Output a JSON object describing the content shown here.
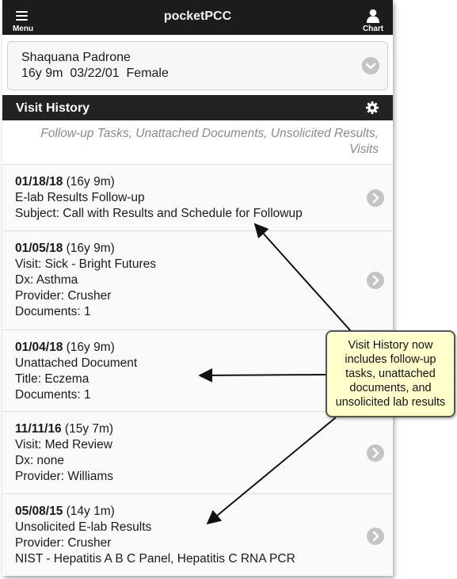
{
  "header": {
    "menu_label": "Menu",
    "title": "pocketPCC",
    "chart_label": "Chart"
  },
  "patient": {
    "name": "Shaquana Padrone",
    "info": "16y 9m  03/22/01  Female"
  },
  "section": {
    "title": "Visit History",
    "filter_text": "Follow-up Tasks, Unattached Documents, Unsolicited Results, Visits"
  },
  "visits": [
    {
      "date": "01/18/18",
      "age": " (16y 9m)",
      "lines": [
        "E-lab Results Follow-up",
        "Subject: Call with Results and Schedule for Followup"
      ]
    },
    {
      "date": "01/05/18",
      "age": " (16y 9m)",
      "lines": [
        "Visit: Sick - Bright Futures",
        "Dx: Asthma",
        "Provider: Crusher",
        "Documents: 1"
      ]
    },
    {
      "date": "01/04/18",
      "age": " (16y 9m)",
      "lines": [
        "Unattached Document",
        "Title: Eczema",
        "Documents: 1"
      ]
    },
    {
      "date": "11/11/16",
      "age": " (15y 7m)",
      "lines": [
        "Visit: Med Review",
        "Dx: none",
        "Provider: Williams"
      ]
    },
    {
      "date": "05/08/15",
      "age": " (14y 1m)",
      "lines": [
        "Unsolicited E-lab Results",
        "Provider: Crusher",
        "NIST - Hepatitis A B C Panel, Hepatitis C RNA PCR"
      ]
    }
  ],
  "callout": {
    "text": "Visit History now includes follow-up tasks, unattached documents, and unsolicited lab results"
  },
  "icons": {
    "menu": "hamburger-icon",
    "chart": "person-icon",
    "settings": "gear-icon",
    "row": "chevron-right-icon",
    "patient": "chevron-down-icon"
  },
  "colors": {
    "header": "#1c1c1c",
    "callout_bg": "#ffffcc",
    "subtitle": "#8a8a8a"
  }
}
